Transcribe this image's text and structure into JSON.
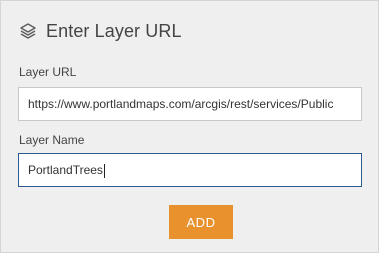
{
  "header": {
    "icon": "layers-icon",
    "title": "Enter Layer URL"
  },
  "form": {
    "url_label": "Layer URL",
    "url_value": "https://www.portlandmaps.com/arcgis/rest/services/Public",
    "name_label": "Layer Name",
    "name_value": "PortlandTrees"
  },
  "actions": {
    "add_label": "ADD"
  },
  "colors": {
    "accent": "#e8912d",
    "focus_border": "#2d5b8f",
    "panel_bg": "#efefef"
  }
}
